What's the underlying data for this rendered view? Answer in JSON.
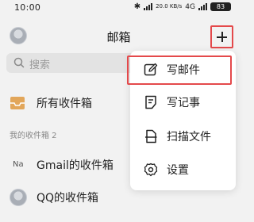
{
  "status_bar": {
    "time": "10:00",
    "network_speed": "20.0 KB/s",
    "network_type": "4G",
    "battery": "83"
  },
  "header": {
    "title": "邮箱"
  },
  "search": {
    "placeholder": "搜索"
  },
  "mailbox_list": {
    "all_inboxes": "所有收件箱",
    "section_label": "我的收件箱 2",
    "accounts": [
      {
        "badge": "Na",
        "label": "Gmail的收件箱"
      },
      {
        "label": "QQ的收件箱"
      }
    ]
  },
  "menu": {
    "items": [
      {
        "label": "写邮件",
        "icon": "compose-icon"
      },
      {
        "label": "写记事",
        "icon": "note-icon"
      },
      {
        "label": "扫描文件",
        "icon": "scan-document-icon"
      },
      {
        "label": "设置",
        "icon": "gear-icon"
      }
    ]
  },
  "colors": {
    "highlight": "#e4494b",
    "background": "#f2f2f2",
    "tray_icon": "#e2a65a"
  }
}
